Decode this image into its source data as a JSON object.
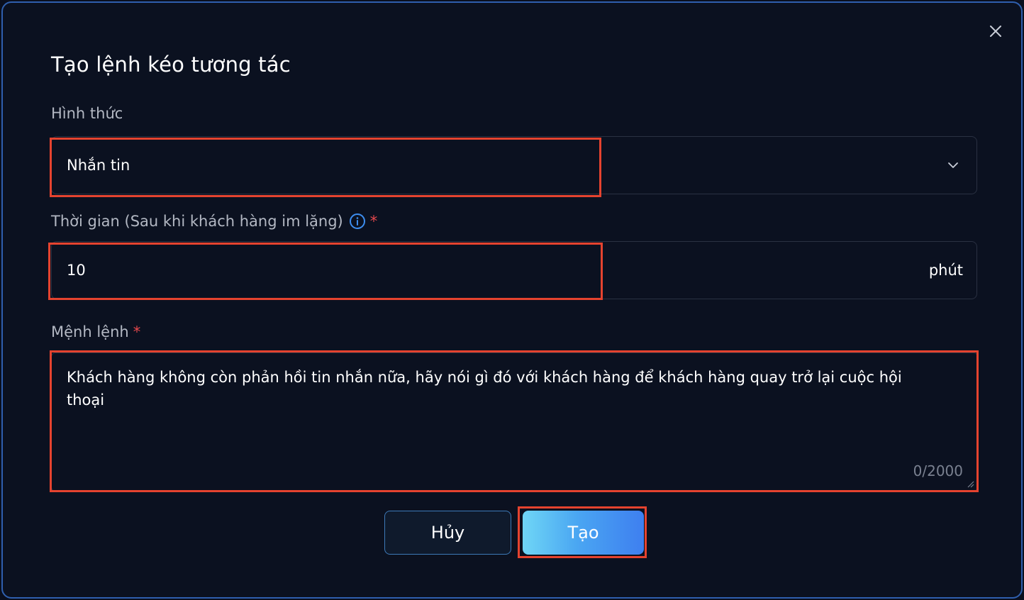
{
  "dialog": {
    "title": "Tạo lệnh kéo tương tác",
    "close_icon": "close-icon"
  },
  "form": {
    "type": {
      "label": "Hình thức",
      "value": "Nhắn tin",
      "icon": "chevron-down-icon"
    },
    "time": {
      "label": "Thời gian (Sau khi khách hàng im lặng)",
      "info_icon": "info-icon",
      "required_mark": "*",
      "value": "10",
      "unit": "phút"
    },
    "command": {
      "label": "Mệnh lệnh",
      "required_mark": "*",
      "value": "Khách hàng không còn phản hồi tin nhắn nữa, hãy nói gì đó với khách hàng để khách hàng quay trở lại cuộc hội thoại",
      "counter": "0/2000"
    }
  },
  "actions": {
    "cancel_label": "Hủy",
    "create_label": "Tạo"
  },
  "colors": {
    "background": "#0b1120",
    "border": "#2a3142",
    "highlight": "#e5432f",
    "accent_gradient_start": "#6fd6f6",
    "accent_gradient_end": "#3e7ff0",
    "required": "#e5484d",
    "info": "#3d8ef0"
  }
}
